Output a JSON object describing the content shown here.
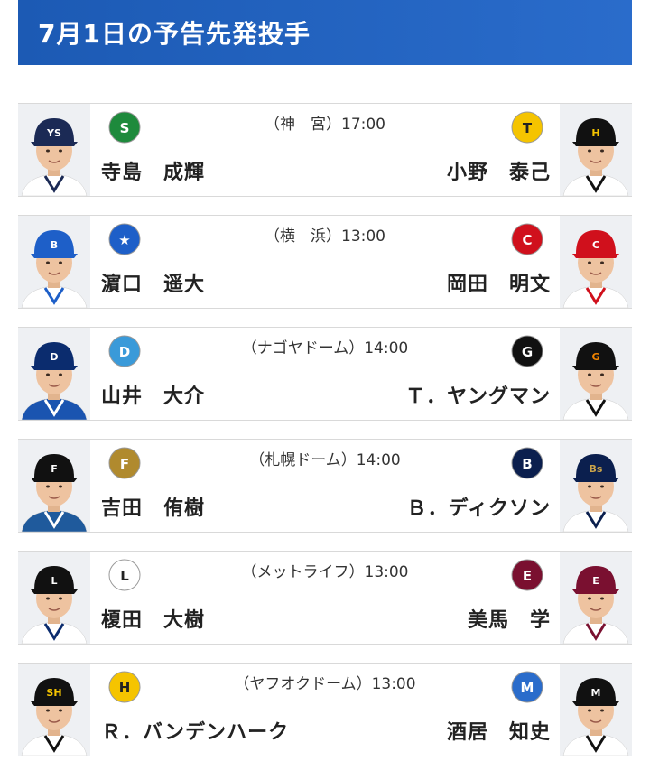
{
  "header": {
    "title": "7月1日の予告先発投手"
  },
  "games": [
    {
      "venue": "（神　宮）17:00",
      "left": {
        "pitcher": "寺島　成輝",
        "team_logo": "swallows-logo",
        "cap": "#1b2a55",
        "cap_mark": "YS",
        "mark_color": "#ffffff",
        "shirt": "#ffffff",
        "stripe": "#1b2a55"
      },
      "right": {
        "pitcher": "小野　泰己",
        "team_logo": "tigers-logo",
        "cap": "#111111",
        "cap_mark": "H",
        "mark_color": "#f5c400",
        "shirt": "#ffffff",
        "stripe": "#111111"
      }
    },
    {
      "venue": "（横　浜）13:00",
      "left": {
        "pitcher": "濵口　遥大",
        "team_logo": "baystars-logo",
        "cap": "#1e5fc8",
        "cap_mark": "B",
        "mark_color": "#ffffff",
        "shirt": "#ffffff",
        "stripe": "#1e5fc8"
      },
      "right": {
        "pitcher": "岡田　明文",
        "team_logo": "carp-logo",
        "cap": "#d0101c",
        "cap_mark": "C",
        "mark_color": "#ffffff",
        "shirt": "#ffffff",
        "stripe": "#d0101c"
      }
    },
    {
      "venue": "（ナゴヤドーム）14:00",
      "left": {
        "pitcher": "山井　大介",
        "team_logo": "dragons-logo",
        "cap": "#0b2c6e",
        "cap_mark": "D",
        "mark_color": "#ffffff",
        "shirt": "#1a54b0",
        "stripe": "#ffffff"
      },
      "right": {
        "pitcher": "Ｔ．ヤングマン",
        "team_logo": "giants-logo",
        "cap": "#111111",
        "cap_mark": "G",
        "mark_color": "#f08300",
        "shirt": "#ffffff",
        "stripe": "#111111"
      }
    },
    {
      "venue": "（札幌ドーム）14:00",
      "left": {
        "pitcher": "吉田　侑樹",
        "team_logo": "fighters-logo",
        "cap": "#111111",
        "cap_mark": "F",
        "mark_color": "#ffffff",
        "shirt": "#1f5a9c",
        "stripe": "#ffffff"
      },
      "right": {
        "pitcher": "Ｂ．ディクソン",
        "team_logo": "buffaloes-logo",
        "cap": "#0b1f4e",
        "cap_mark": "Bs",
        "mark_color": "#c9a34a",
        "shirt": "#ffffff",
        "stripe": "#0b1f4e"
      }
    },
    {
      "venue": "（メットライフ）13:00",
      "left": {
        "pitcher": "榎田　大樹",
        "team_logo": "lions-logo",
        "cap": "#111111",
        "cap_mark": "L",
        "mark_color": "#ffffff",
        "shirt": "#ffffff",
        "stripe": "#0b2c6e"
      },
      "right": {
        "pitcher": "美馬　学",
        "team_logo": "eagles-logo",
        "cap": "#7a1030",
        "cap_mark": "E",
        "mark_color": "#ffffff",
        "shirt": "#ffffff",
        "stripe": "#7a1030"
      }
    },
    {
      "venue": "（ヤフオクドーム）13:00",
      "left": {
        "pitcher": "Ｒ．バンデンハーク",
        "team_logo": "hawks-logo",
        "cap": "#111111",
        "cap_mark": "SH",
        "mark_color": "#f5c400",
        "shirt": "#ffffff",
        "stripe": "#111111"
      },
      "right": {
        "pitcher": "酒居　知史",
        "team_logo": "marines-logo",
        "cap": "#111111",
        "cap_mark": "M",
        "mark_color": "#ffffff",
        "shirt": "#ffffff",
        "stripe": "#111111"
      }
    }
  ],
  "logos": {
    "swallows-logo": {
      "bg": "#1e8a3c",
      "text": "S"
    },
    "tigers-logo": {
      "bg": "#f5c400",
      "text": "T"
    },
    "baystars-logo": {
      "bg": "#1e5fc8",
      "text": "★"
    },
    "carp-logo": {
      "bg": "#d0101c",
      "text": "C"
    },
    "dragons-logo": {
      "bg": "#3a9ad9",
      "text": "D"
    },
    "giants-logo": {
      "bg": "#111111",
      "text": "G"
    },
    "fighters-logo": {
      "bg": "#b08a2e",
      "text": "F"
    },
    "buffaloes-logo": {
      "bg": "#0b1f4e",
      "text": "B"
    },
    "lions-logo": {
      "bg": "#ffffff",
      "text": "L"
    },
    "eagles-logo": {
      "bg": "#7a1030",
      "text": "E"
    },
    "hawks-logo": {
      "bg": "#f5c400",
      "text": "H"
    },
    "marines-logo": {
      "bg": "#2a6ccb",
      "text": "M"
    }
  }
}
